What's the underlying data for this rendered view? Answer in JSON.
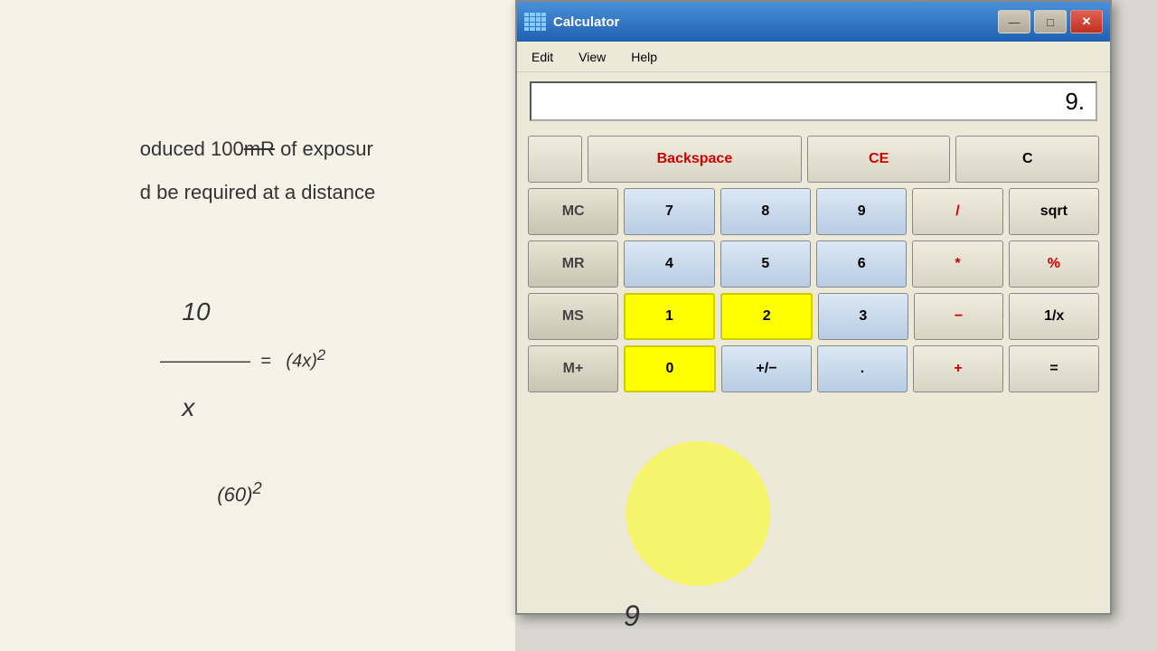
{
  "background": {
    "notes_lines": [
      "oduced 100mR of exposur",
      "d be required at a distance"
    ],
    "math_expressions": [
      "10",
      "—————  =",
      "x"
    ]
  },
  "window": {
    "title": "Calculator",
    "icon": "calculator-icon"
  },
  "titlebar": {
    "title": "Calculator",
    "minimize_label": "—",
    "restore_label": "□",
    "close_label": "✕"
  },
  "menubar": {
    "items": [
      "Edit",
      "View",
      "Help"
    ]
  },
  "display": {
    "value": "9."
  },
  "buttons": {
    "row0": {
      "blank": "",
      "backspace": "Backspace",
      "ce": "CE",
      "c": "C"
    },
    "row1": {
      "mc": "MC",
      "seven": "7",
      "eight": "8",
      "nine": "9",
      "divide": "/",
      "sqrt": "sqrt"
    },
    "row2": {
      "mr": "MR",
      "four": "4",
      "five": "5",
      "six": "6",
      "multiply": "*",
      "percent": "%"
    },
    "row3": {
      "ms": "MS",
      "one": "1",
      "two": "2",
      "three": "3",
      "subtract": "−",
      "reciprocal": "1/x"
    },
    "row4": {
      "mplus": "M+",
      "zero": "0",
      "plusminus": "+/−",
      "decimal": ".",
      "add": "+",
      "equals": "="
    }
  },
  "colors": {
    "titlebar_gradient_start": "#4a90d9",
    "titlebar_gradient_end": "#2060b0",
    "highlight_yellow": "#ffff00",
    "operator_red": "#cc0000",
    "number_bg": "#dce8f4"
  }
}
